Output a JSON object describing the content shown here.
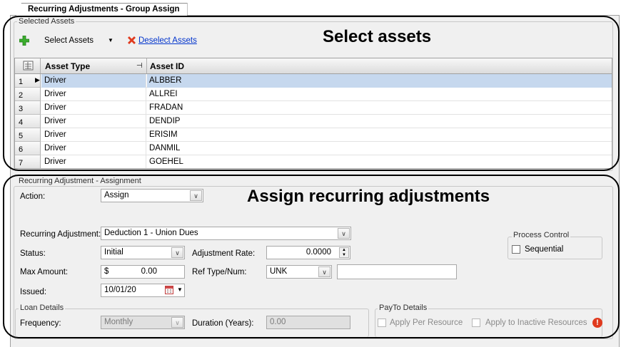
{
  "tab": {
    "title": "Recurring Adjustments - Group Assign"
  },
  "selected_assets": {
    "group_title": "Selected Assets",
    "select_assets_label": "Select Assets",
    "deselect_assets_label": "Deselect Assets",
    "columns": [
      "Asset Type",
      "Asset ID"
    ],
    "rows": [
      {
        "num": "1",
        "type": "Driver",
        "id": "ALBBER"
      },
      {
        "num": "2",
        "type": "Driver",
        "id": "ALLREI"
      },
      {
        "num": "3",
        "type": "Driver",
        "id": "FRADAN"
      },
      {
        "num": "4",
        "type": "Driver",
        "id": "DENDIP"
      },
      {
        "num": "5",
        "type": "Driver",
        "id": "ERISIM"
      },
      {
        "num": "6",
        "type": "Driver",
        "id": "DANMIL"
      },
      {
        "num": "7",
        "type": "Driver",
        "id": "GOEHEL"
      }
    ]
  },
  "callouts": {
    "select": "Select assets",
    "assign": "Assign recurring adjustments"
  },
  "assignment": {
    "group_title": "Recurring Adjustment - Assignment",
    "action_label": "Action:",
    "action_value": "Assign",
    "recurring_adjustment_label": "Recurring Adjustment:",
    "recurring_adjustment_value": "Deduction 1 - Union Dues",
    "status_label": "Status:",
    "status_value": "Initial",
    "adjustment_rate_label": "Adjustment Rate:",
    "adjustment_rate_value": "0.0000",
    "max_amount_label": "Max Amount:",
    "max_amount_currency": "$",
    "max_amount_value": "0.00",
    "ref_type_label": "Ref Type/Num:",
    "ref_type_value": "UNK",
    "ref_num_value": "",
    "issued_label": "Issued:",
    "issued_value": "10/01/20"
  },
  "process_control": {
    "title": "Process Control",
    "sequential_label": "Sequential"
  },
  "loan_details": {
    "title": "Loan Details",
    "frequency_label": "Frequency:",
    "frequency_value": "Monthly",
    "duration_label": "Duration (Years):",
    "duration_value": "0.00"
  },
  "payto_details": {
    "title": "PayTo Details",
    "apply_per_resource_label": "Apply Per Resource",
    "apply_inactive_label": "Apply to Inactive Resources"
  },
  "colors": {
    "selection": "#c6d8ee",
    "warning": "#e03a1e",
    "add_green": "#3cae2e"
  }
}
